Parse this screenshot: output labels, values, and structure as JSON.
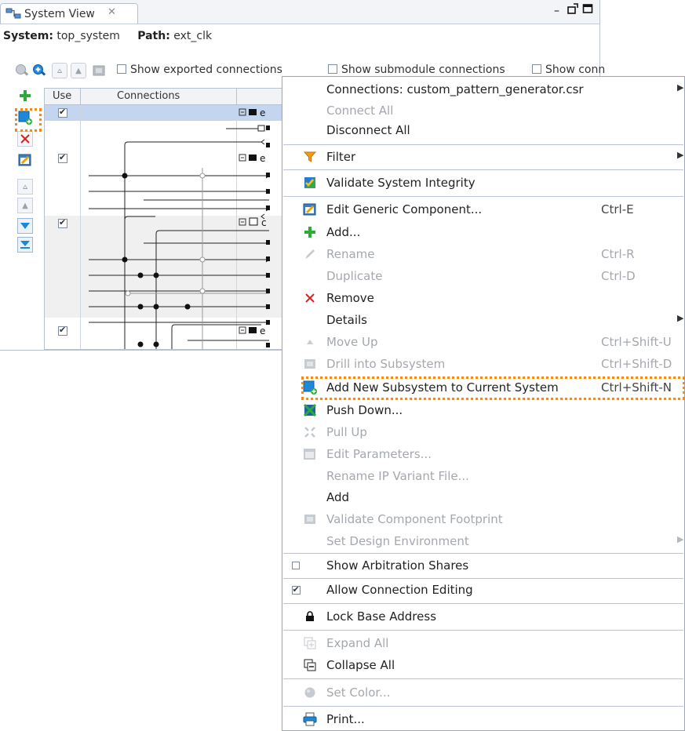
{
  "window": {
    "tab_title": "System View",
    "tab_close": "✕"
  },
  "breadcrumb": {
    "system_label": "System:",
    "system_value": "top_system",
    "path_label": "Path:",
    "path_value": "ext_clk"
  },
  "toolbar": {
    "show_exported": "Show exported connections",
    "show_submodule": "Show submodule connections",
    "show_conn_partial": "Show conn"
  },
  "grid": {
    "col_use": "Use",
    "col_connections": "Connections"
  },
  "menu": {
    "items": [
      {
        "label": "Connections: custom_pattern_generator.csr",
        "shortcut": "",
        "disabled": false,
        "submenu": true
      },
      {
        "label": "Connect All",
        "shortcut": "",
        "disabled": true,
        "submenu": false
      },
      {
        "label": "Disconnect All",
        "shortcut": "",
        "disabled": false,
        "submenu": false
      },
      {
        "label": "Filter",
        "shortcut": "",
        "disabled": false,
        "submenu": true,
        "icon": "filter-icon"
      },
      {
        "label": "Validate System Integrity",
        "shortcut": "",
        "disabled": false,
        "submenu": false,
        "icon": "validate-system-icon"
      },
      {
        "label": "Edit Generic Component...",
        "shortcut": "Ctrl-E",
        "disabled": false,
        "submenu": false,
        "icon": "edit-component-icon"
      },
      {
        "label": "Add...",
        "shortcut": "",
        "disabled": false,
        "submenu": false,
        "icon": "add-icon"
      },
      {
        "label": "Rename",
        "shortcut": "Ctrl-R",
        "disabled": true,
        "submenu": false,
        "icon": "pencil-icon"
      },
      {
        "label": "Duplicate",
        "shortcut": "Ctrl-D",
        "disabled": true,
        "submenu": false
      },
      {
        "label": "Remove",
        "shortcut": "",
        "disabled": false,
        "submenu": false,
        "icon": "remove-icon"
      },
      {
        "label": "Details",
        "shortcut": "",
        "disabled": false,
        "submenu": true
      },
      {
        "label": "Move Up",
        "shortcut": "Ctrl+Shift-U",
        "disabled": true,
        "submenu": false,
        "icon": "move-up-icon"
      },
      {
        "label": "Drill into Subsystem",
        "shortcut": "Ctrl+Shift-D",
        "disabled": true,
        "submenu": false,
        "icon": "drill-subsystem-icon"
      },
      {
        "label": "Add New Subsystem to Current System",
        "shortcut": "Ctrl+Shift-N",
        "disabled": false,
        "submenu": false,
        "icon": "add-subsystem-icon"
      },
      {
        "label": "Push Down...",
        "shortcut": "",
        "disabled": false,
        "submenu": false,
        "icon": "push-down-icon"
      },
      {
        "label": "Pull Up",
        "shortcut": "",
        "disabled": true,
        "submenu": false,
        "icon": "pull-up-icon"
      },
      {
        "label": "Edit Parameters...",
        "shortcut": "",
        "disabled": true,
        "submenu": false,
        "icon": "edit-parameters-icon"
      },
      {
        "label": "Rename IP Variant File...",
        "shortcut": "",
        "disabled": true,
        "submenu": false
      },
      {
        "label": "Add",
        "shortcut": "",
        "disabled": false,
        "submenu": false
      },
      {
        "label": "Validate Component Footprint",
        "shortcut": "",
        "disabled": true,
        "submenu": false,
        "icon": "validate-footprint-icon"
      },
      {
        "label": "Set Design Environment",
        "shortcut": "",
        "disabled": true,
        "submenu": true
      },
      {
        "label": "Show Arbitration Shares",
        "shortcut": "",
        "disabled": false,
        "submenu": false,
        "checkbox": false
      },
      {
        "label": "Allow Connection Editing",
        "shortcut": "",
        "disabled": false,
        "submenu": false,
        "checkbox": true
      },
      {
        "label": "Lock Base Address",
        "shortcut": "",
        "disabled": false,
        "submenu": false,
        "icon": "lock-icon"
      },
      {
        "label": "Expand All",
        "shortcut": "",
        "disabled": true,
        "submenu": false,
        "icon": "expand-all-icon"
      },
      {
        "label": "Collapse All",
        "shortcut": "",
        "disabled": false,
        "submenu": false,
        "icon": "collapse-all-icon"
      },
      {
        "label": "Set Color...",
        "shortcut": "",
        "disabled": true,
        "submenu": false,
        "icon": "color-icon"
      },
      {
        "label": "Print...",
        "shortcut": "",
        "disabled": false,
        "submenu": false,
        "icon": "print-icon"
      }
    ]
  },
  "colors": {
    "highlight": "#f08a1a",
    "accent_blue": "#1e88d8",
    "add_green": "#2eaa3a",
    "remove_red": "#e02020"
  }
}
